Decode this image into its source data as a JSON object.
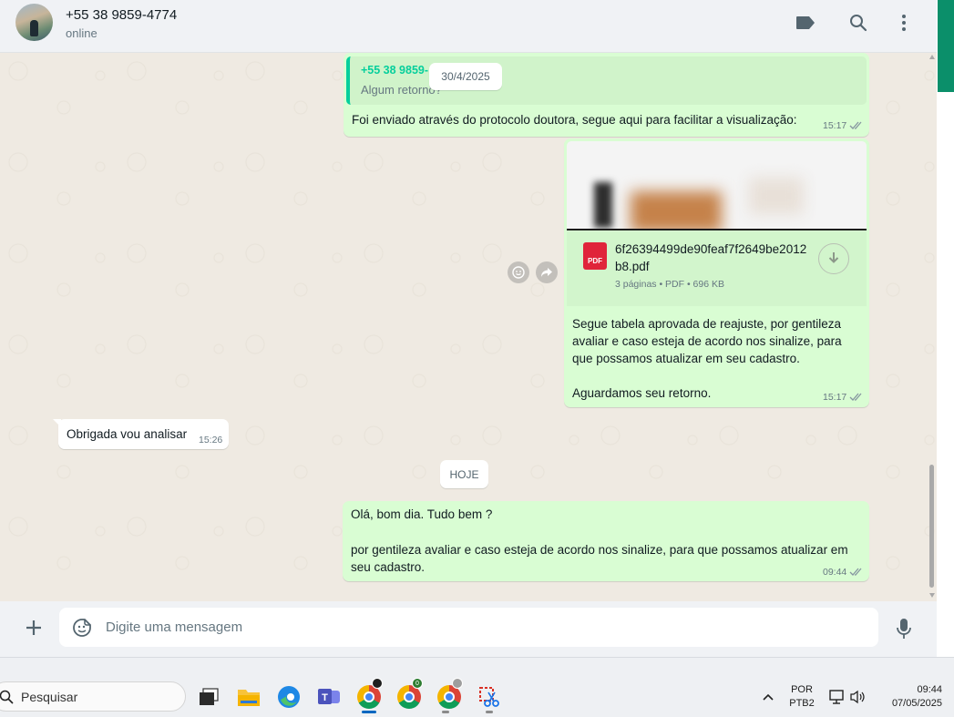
{
  "header": {
    "contact_name": "+55 38 9859-4774",
    "status": "online",
    "icons": [
      "label-icon",
      "search-icon",
      "menu-icon"
    ]
  },
  "chat": {
    "floating_date": "30/4/2025",
    "quoted": {
      "name": "+55 38 9859-",
      "text": "Algum retorno?"
    },
    "msg1": {
      "text": "Foi enviado através do protocolo doutora, segue aqui para facilitar a visualização:",
      "time": "15:17"
    },
    "document": {
      "filename": "6f26394499de90feaf7f2649be2012b8.pdf",
      "info": "3 páginas • PDF • 696 KB",
      "icon_label": "PDF",
      "caption_line1": "Segue tabela aprovada de reajuste, por gentileza avaliar e caso esteja de acordo nos sinalize, para que possamos atualizar em seu cadastro.",
      "caption_line2": "Aguardamos seu retorno.",
      "time": "15:17"
    },
    "incoming": {
      "text": "Obrigada vou analisar",
      "time": "15:26"
    },
    "today_label": "HOJE",
    "last_msg": {
      "line1": "Olá, bom dia. Tudo bem ?",
      "line2": "por gentileza avaliar e caso esteja de acordo nos sinalize, para que possamos atualizar em seu cadastro.",
      "time": "09:44"
    }
  },
  "composer": {
    "placeholder": "Digite uma mensagem"
  },
  "taskbar": {
    "search_label": "Pesquisar",
    "apps": [
      "task-view",
      "file-explorer",
      "edge",
      "teams",
      "chrome",
      "chrome",
      "chrome",
      "snipping-tool"
    ],
    "tray_lang_1": "POR",
    "tray_lang_2": "PTB2",
    "time": "09:44",
    "date": "07/05/2025",
    "chrome_badge_1": "0"
  },
  "colors": {
    "outgoing_bubble": "#d9fdd3",
    "incoming_bubble": "#ffffff",
    "chat_background": "#efeae2",
    "accent_green": "#06cf9c",
    "read_ticks": "#8696a0",
    "pdf_red": "#e0243a"
  }
}
